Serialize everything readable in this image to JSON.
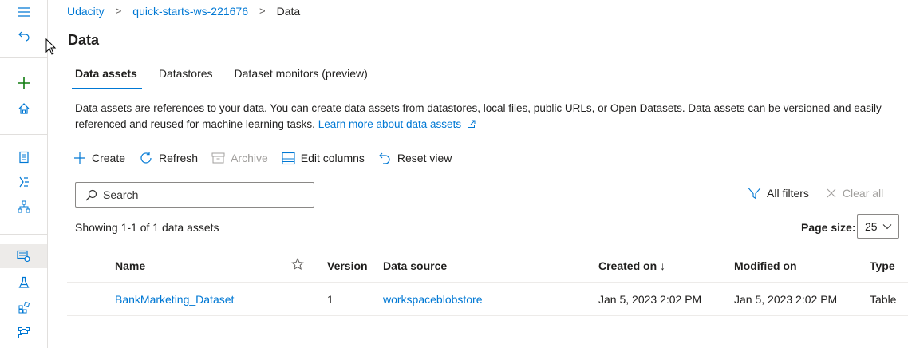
{
  "breadcrumb": {
    "items": [
      "Udacity",
      "quick-starts-ws-221676",
      "Data"
    ]
  },
  "page_title": "Data",
  "tabs": [
    {
      "label": "Data assets",
      "active": true
    },
    {
      "label": "Datastores",
      "active": false
    },
    {
      "label": "Dataset monitors (preview)",
      "active": false
    }
  ],
  "description": {
    "text": "Data assets are references to your data. You can create data assets from datastores, local files, public URLs, or Open Datasets. Data assets can be versioned and easily referenced and reused for machine learning tasks.",
    "link": "Learn more about data assets"
  },
  "toolbar": {
    "create": "Create",
    "refresh": "Refresh",
    "archive": "Archive",
    "edit_columns": "Edit columns",
    "reset_view": "Reset view"
  },
  "search": {
    "placeholder": "Search"
  },
  "filters": {
    "all_filters": "All filters",
    "clear_all": "Clear all"
  },
  "showing": "Showing 1-1 of 1 data assets",
  "page_size": {
    "label": "Page size:",
    "value": "25"
  },
  "table": {
    "columns": {
      "name": "Name",
      "version": "Version",
      "data_source": "Data source",
      "created_on": "Created on ↓",
      "modified_on": "Modified on",
      "type": "Type"
    },
    "rows": [
      {
        "name": "BankMarketing_Dataset",
        "version": "1",
        "data_source": "workspaceblobstore",
        "created_on": "Jan 5, 2023 2:02 PM",
        "modified_on": "Jan 5, 2023 2:02 PM",
        "type": "Table"
      }
    ]
  },
  "colors": {
    "accent": "#0078d4",
    "add": "#107c10"
  },
  "icons": [
    "hamburger-icon",
    "back-icon",
    "add-icon",
    "home-icon",
    "notebook-icon",
    "automl-icon",
    "designer-icon",
    "data-icon",
    "experiment-icon",
    "components-icon",
    "pipelines-icon"
  ]
}
